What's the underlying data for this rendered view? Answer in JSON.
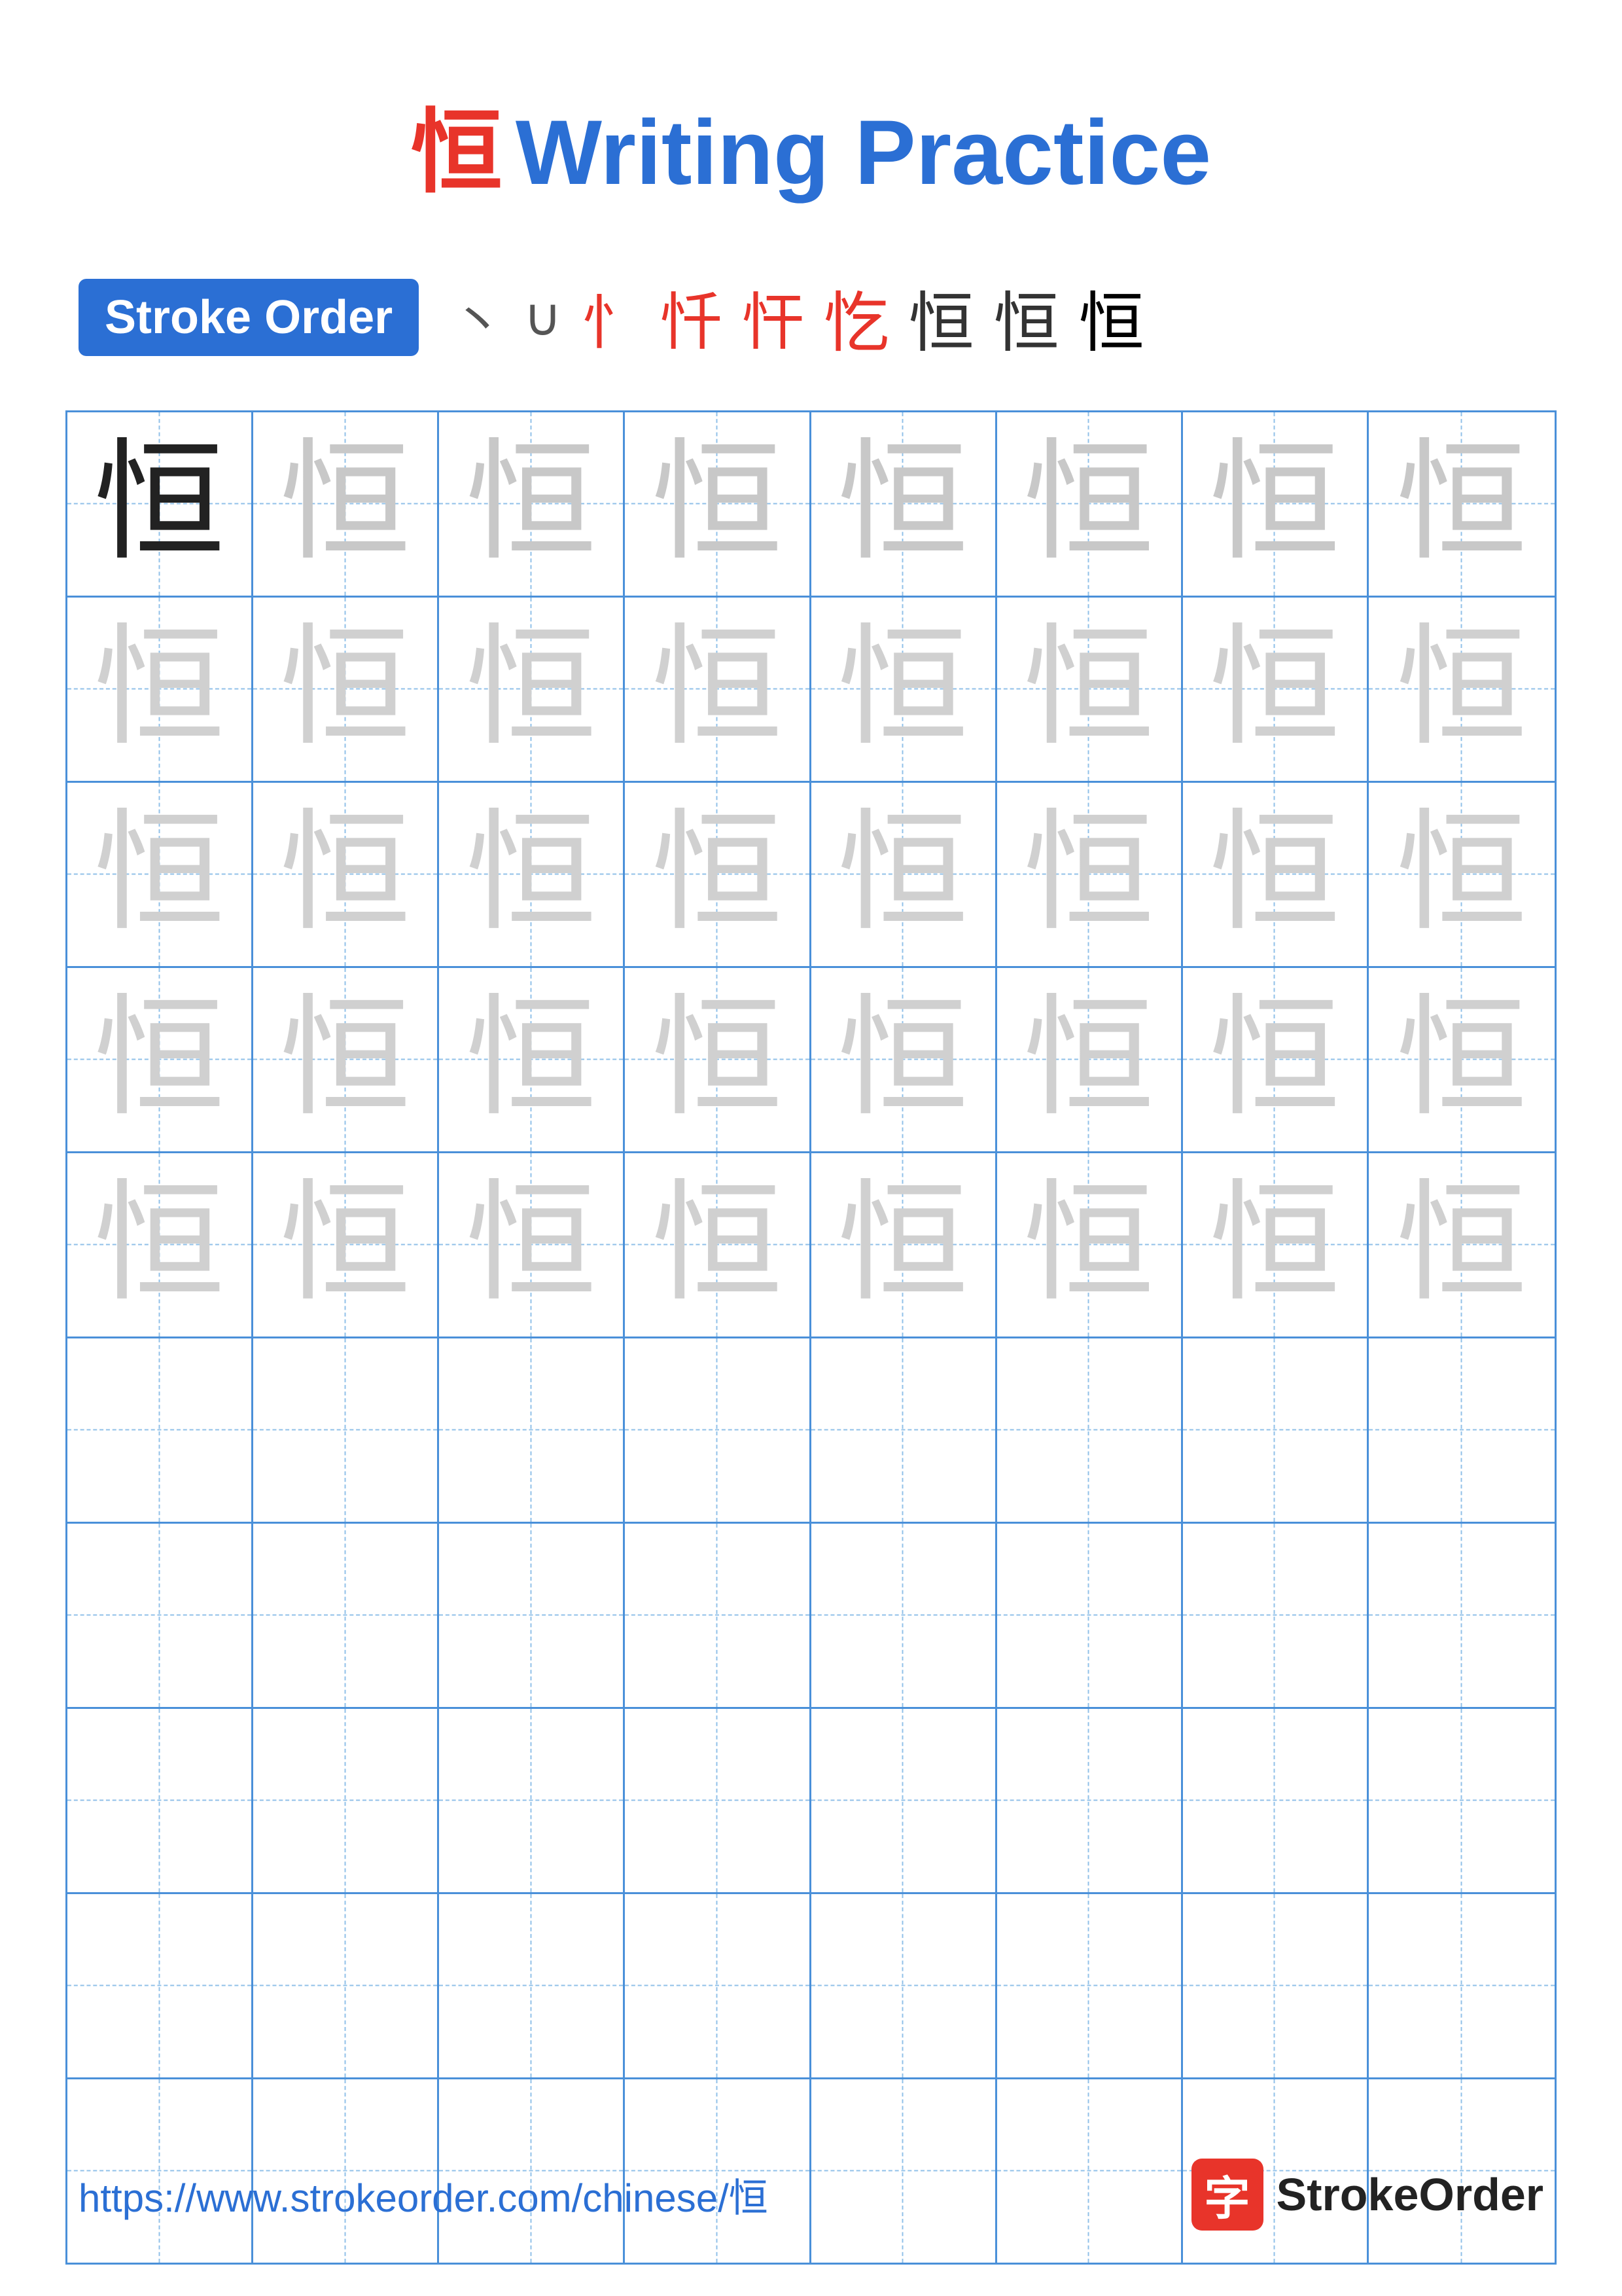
{
  "title": {
    "chinese": "恒",
    "english": "Writing Practice"
  },
  "stroke_order": {
    "badge_label": "Stroke Order",
    "strokes": [
      "丶",
      "∪",
      "忄",
      "忏",
      "忓",
      "忔",
      "恒",
      "恒",
      "恒"
    ]
  },
  "grid": {
    "rows": 10,
    "cols": 8,
    "character": "恒",
    "practice_rows": 5,
    "empty_rows": 5
  },
  "footer": {
    "url": "https://www.strokeorder.com/chinese/恒",
    "brand_char": "字",
    "brand_name": "StrokeOrder"
  }
}
